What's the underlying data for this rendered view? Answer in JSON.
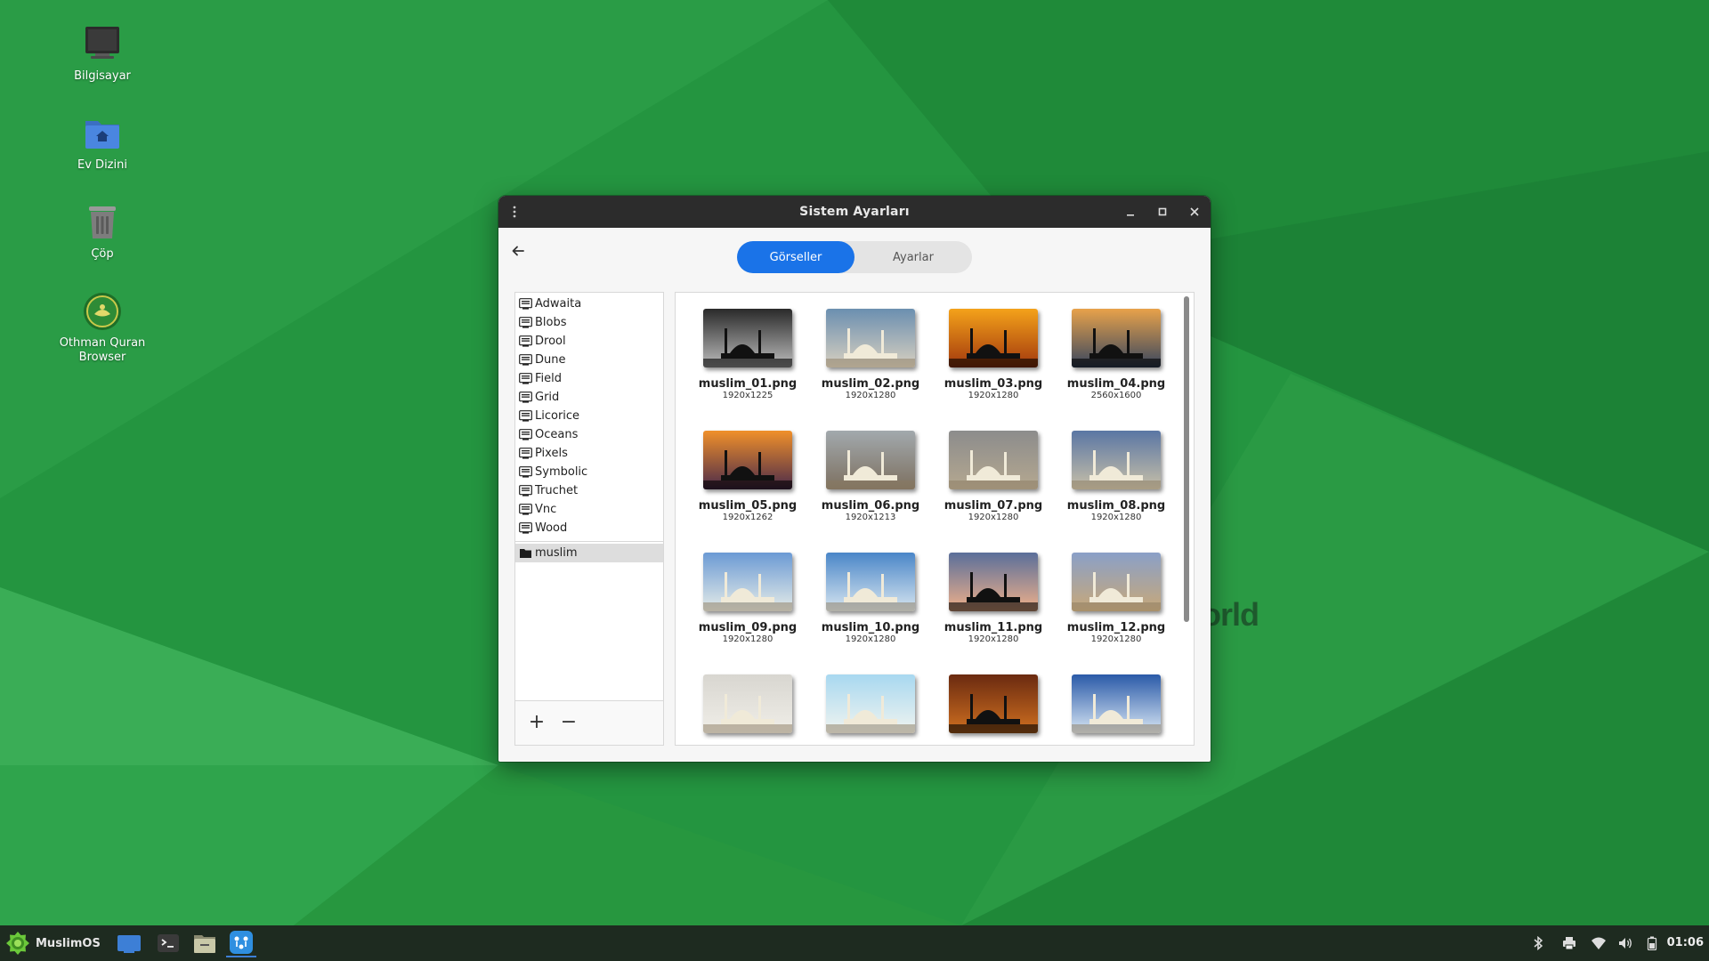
{
  "desktop": {
    "icons": [
      {
        "label": "Bilgisayar",
        "icon": "computer-icon"
      },
      {
        "label": "Ev Dizini",
        "icon": "home-folder-icon"
      },
      {
        "label": "Çöp",
        "icon": "trash-icon"
      },
      {
        "label": "Othman Quran Browser",
        "icon": "quran-app-icon"
      }
    ],
    "watermark": "orld"
  },
  "window": {
    "title": "Sistem Ayarları",
    "tabs": [
      {
        "label": "Görseller",
        "active": true
      },
      {
        "label": "Ayarlar",
        "active": false
      }
    ],
    "themes": [
      "Adwaita",
      "Blobs",
      "Drool",
      "Dune",
      "Field",
      "Grid",
      "Licorice",
      "Oceans",
      "Pixels",
      "Symbolic",
      "Truchet",
      "Vnc",
      "Wood"
    ],
    "folder": "muslim",
    "add_label": "+",
    "remove_label": "−",
    "images": [
      {
        "name": "muslim_01.png",
        "size": "1920x1225"
      },
      {
        "name": "muslim_02.png",
        "size": "1920x1280"
      },
      {
        "name": "muslim_03.png",
        "size": "1920x1280"
      },
      {
        "name": "muslim_04.png",
        "size": "2560x1600"
      },
      {
        "name": "muslim_05.png",
        "size": "1920x1262"
      },
      {
        "name": "muslim_06.png",
        "size": "1920x1213"
      },
      {
        "name": "muslim_07.png",
        "size": "1920x1280"
      },
      {
        "name": "muslim_08.png",
        "size": "1920x1280"
      },
      {
        "name": "muslim_09.png",
        "size": "1920x1280"
      },
      {
        "name": "muslim_10.png",
        "size": "1920x1280"
      },
      {
        "name": "muslim_11.png",
        "size": "1920x1280"
      },
      {
        "name": "muslim_12.png",
        "size": "1920x1280"
      },
      {
        "name": "",
        "size": ""
      },
      {
        "name": "",
        "size": ""
      },
      {
        "name": "",
        "size": ""
      },
      {
        "name": "",
        "size": ""
      }
    ]
  },
  "taskbar": {
    "start_label": "MuslimOS",
    "clock": "01:06",
    "apps": [
      "show-desktop-icon",
      "terminal-icon",
      "file-manager-icon",
      "settings-app-icon"
    ],
    "tray": [
      "bluetooth-icon",
      "printer-icon",
      "wifi-icon",
      "volume-icon",
      "battery-icon"
    ]
  }
}
